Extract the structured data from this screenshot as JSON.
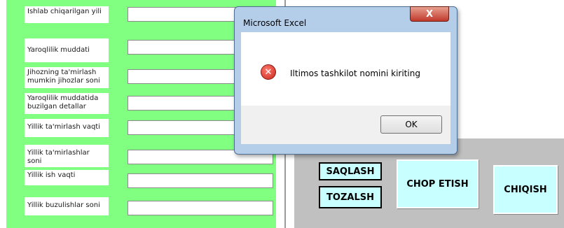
{
  "form": {
    "labels": [
      "Ishlab chiqarilgan yili",
      "Yaroqlilik muddati",
      "Jihozning ta'mirlash mumkin jihozlar soni",
      "Yaroqlilik muddatida buzilgan detallar",
      "Yillik ta'mirlash vaqti",
      "Yillik ta'mirlashlar soni",
      "Yillik ish vaqti",
      "Yillik buzulishlar soni"
    ],
    "values": [
      "",
      "",
      "",
      "",
      "",
      "",
      "",
      ""
    ]
  },
  "buttons": {
    "save": "SAQLASH",
    "clear": "TOZALSH",
    "print": "CHOP ETISH",
    "exit": "CHIQISH"
  },
  "dialog": {
    "title": "Microsoft Excel",
    "close_label": "X",
    "icon": "error-icon",
    "message": "Iltimos tashkilot nomini kiriting",
    "ok_label": "OK"
  },
  "colors": {
    "form_background": "#80ff80",
    "button_background": "#c8ffff",
    "gray_panel": "#c0c0c0"
  }
}
